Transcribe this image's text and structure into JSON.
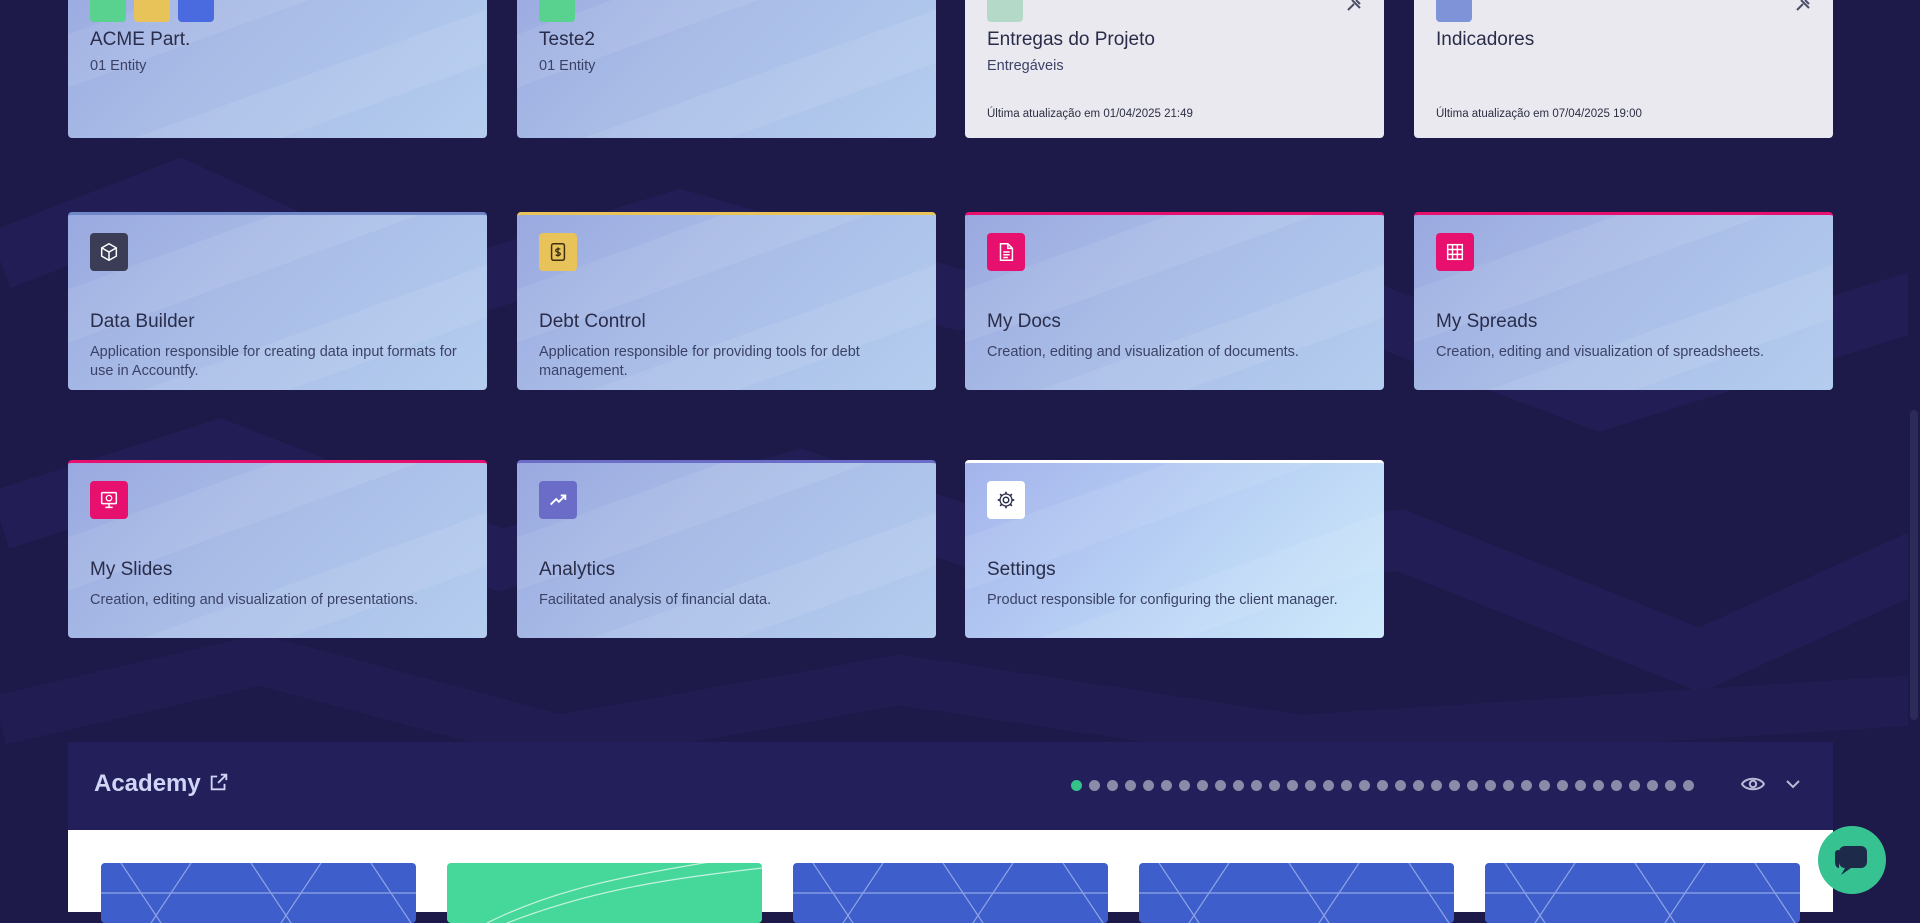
{
  "colors": {
    "background": "#1d1a4a",
    "card_gradient_start": "#9aa9e0",
    "card_gradient_end": "#b4cdef",
    "accent_green": "#36c391",
    "dot_active": "#34c28a",
    "dot_inactive": "#8b8aa8",
    "yellow": "#e8c35a",
    "pink": "#e8106e",
    "purple": "#6a6cc7",
    "dark": "#3a3d55"
  },
  "cards": {
    "acme": {
      "title": "ACME Part.",
      "sub": "01 Entity"
    },
    "teste2": {
      "title": "Teste2",
      "sub": "01 Entity"
    },
    "entregas": {
      "title": "Entregas do Projeto",
      "sub": "Entregáveis",
      "meta": "Última atualização em 01/04/2025 21:49"
    },
    "indicadores": {
      "title": "Indicadores",
      "meta": "Última atualização em 07/04/2025 19:00"
    },
    "data_builder": {
      "title": "Data Builder",
      "desc": "Application responsible for creating data input formats for use in Accountfy."
    },
    "debt_control": {
      "title": "Debt Control",
      "desc": "Application responsible for providing tools for debt management."
    },
    "my_docs": {
      "title": "My Docs",
      "desc": "Creation, editing and visualization of documents."
    },
    "my_spreads": {
      "title": "My Spreads",
      "desc": "Creation, editing and visualization of spreadsheets."
    },
    "my_slides": {
      "title": "My Slides",
      "desc": "Creation, editing and visualization of presentations."
    },
    "analytics": {
      "title": "Analytics",
      "desc": "Facilitated analysis of financial data."
    },
    "settings": {
      "title": "Settings",
      "desc": "Product responsible for configuring the client manager."
    }
  },
  "academy": {
    "title": "Academy",
    "carousel_dot_count": 35,
    "active_dot_index": 0
  }
}
